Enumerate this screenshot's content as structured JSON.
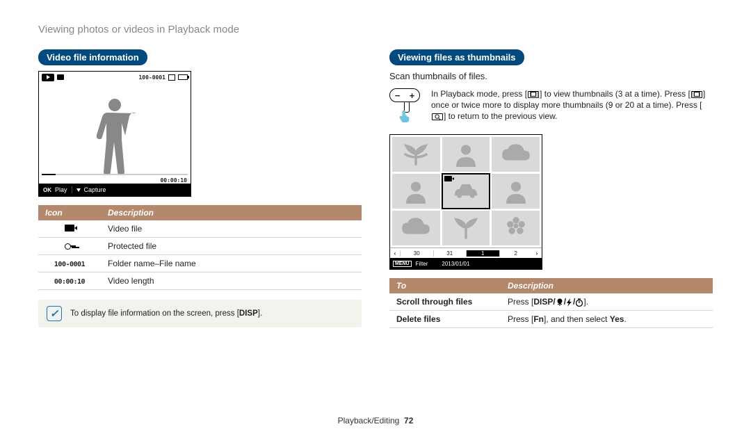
{
  "page_title": "Viewing photos or videos in Playback mode",
  "section1": {
    "heading": "Video file information"
  },
  "video_preview": {
    "folder_label": "100-0001",
    "time": "00:00:10",
    "ok_label": "OK",
    "play_label": "Play",
    "capture_label": "Capture"
  },
  "icon_table": {
    "head_icon": "Icon",
    "head_desc": "Description",
    "rows": [
      {
        "icon_name": "video-file-icon",
        "desc": "Video file"
      },
      {
        "icon_name": "protected-file-icon",
        "desc": "Protected file"
      },
      {
        "icon_name": "folder-filename",
        "icon_text": "100-0001",
        "desc": "Folder name–File name"
      },
      {
        "icon_name": "video-length",
        "icon_text": "00:00:10",
        "desc": "Video length"
      }
    ]
  },
  "note": {
    "text_before": "To display file information on the screen, press [",
    "disp": "DISP",
    "text_after": "]."
  },
  "section2": {
    "heading": "Viewing files as thumbnails",
    "subtext": "Scan thumbnails of files."
  },
  "zoom_caption": {
    "l1a": "In Playback mode, press [",
    "l1b": "] to view thumbnails (3 at a time). Press [",
    "l1c": "] once or twice more to display more thumbnails (9 or 20 at a time). Press [",
    "l1d": "] to return to the previous view."
  },
  "thumb_panel": {
    "nav": {
      "left": "‹",
      "cells": [
        "30",
        "31",
        "1",
        "2"
      ],
      "sel_index": 2,
      "right": "›"
    },
    "bottom": {
      "menu": "MENU",
      "filter": "Filter",
      "date": "2013/01/01"
    }
  },
  "action_table": {
    "head_to": "To",
    "head_desc": "Description",
    "rows": [
      {
        "action": "Scroll through files",
        "prefix": "Press [",
        "labels": "DISP/ / / ",
        "suffix": "]."
      },
      {
        "action": "Delete files",
        "prefix": "Press [",
        "fn": "Fn",
        "mid": "], and then select ",
        "yes": "Yes",
        "suffix": "."
      }
    ]
  },
  "footer": {
    "section": "Playback/Editing",
    "page": "72"
  }
}
